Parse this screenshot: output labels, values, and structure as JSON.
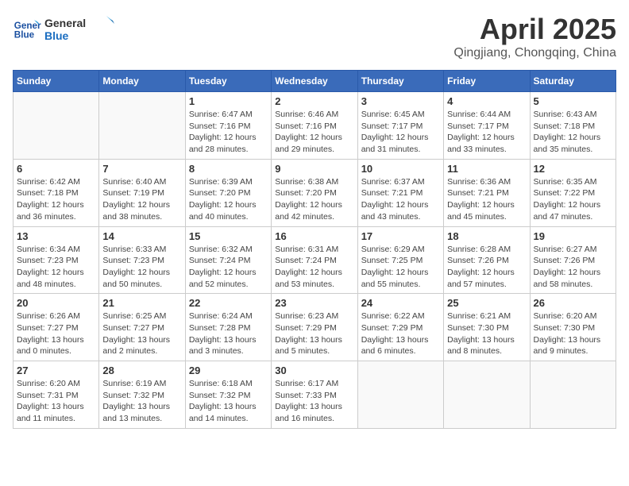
{
  "logo": {
    "line1": "General",
    "line2": "Blue"
  },
  "title": "April 2025",
  "location": "Qingjiang, Chongqing, China",
  "weekdays": [
    "Sunday",
    "Monday",
    "Tuesday",
    "Wednesday",
    "Thursday",
    "Friday",
    "Saturday"
  ],
  "weeks": [
    [
      {
        "day": "",
        "info": ""
      },
      {
        "day": "",
        "info": ""
      },
      {
        "day": "1",
        "info": "Sunrise: 6:47 AM\nSunset: 7:16 PM\nDaylight: 12 hours and 28 minutes."
      },
      {
        "day": "2",
        "info": "Sunrise: 6:46 AM\nSunset: 7:16 PM\nDaylight: 12 hours and 29 minutes."
      },
      {
        "day": "3",
        "info": "Sunrise: 6:45 AM\nSunset: 7:17 PM\nDaylight: 12 hours and 31 minutes."
      },
      {
        "day": "4",
        "info": "Sunrise: 6:44 AM\nSunset: 7:17 PM\nDaylight: 12 hours and 33 minutes."
      },
      {
        "day": "5",
        "info": "Sunrise: 6:43 AM\nSunset: 7:18 PM\nDaylight: 12 hours and 35 minutes."
      }
    ],
    [
      {
        "day": "6",
        "info": "Sunrise: 6:42 AM\nSunset: 7:18 PM\nDaylight: 12 hours and 36 minutes."
      },
      {
        "day": "7",
        "info": "Sunrise: 6:40 AM\nSunset: 7:19 PM\nDaylight: 12 hours and 38 minutes."
      },
      {
        "day": "8",
        "info": "Sunrise: 6:39 AM\nSunset: 7:20 PM\nDaylight: 12 hours and 40 minutes."
      },
      {
        "day": "9",
        "info": "Sunrise: 6:38 AM\nSunset: 7:20 PM\nDaylight: 12 hours and 42 minutes."
      },
      {
        "day": "10",
        "info": "Sunrise: 6:37 AM\nSunset: 7:21 PM\nDaylight: 12 hours and 43 minutes."
      },
      {
        "day": "11",
        "info": "Sunrise: 6:36 AM\nSunset: 7:21 PM\nDaylight: 12 hours and 45 minutes."
      },
      {
        "day": "12",
        "info": "Sunrise: 6:35 AM\nSunset: 7:22 PM\nDaylight: 12 hours and 47 minutes."
      }
    ],
    [
      {
        "day": "13",
        "info": "Sunrise: 6:34 AM\nSunset: 7:23 PM\nDaylight: 12 hours and 48 minutes."
      },
      {
        "day": "14",
        "info": "Sunrise: 6:33 AM\nSunset: 7:23 PM\nDaylight: 12 hours and 50 minutes."
      },
      {
        "day": "15",
        "info": "Sunrise: 6:32 AM\nSunset: 7:24 PM\nDaylight: 12 hours and 52 minutes."
      },
      {
        "day": "16",
        "info": "Sunrise: 6:31 AM\nSunset: 7:24 PM\nDaylight: 12 hours and 53 minutes."
      },
      {
        "day": "17",
        "info": "Sunrise: 6:29 AM\nSunset: 7:25 PM\nDaylight: 12 hours and 55 minutes."
      },
      {
        "day": "18",
        "info": "Sunrise: 6:28 AM\nSunset: 7:26 PM\nDaylight: 12 hours and 57 minutes."
      },
      {
        "day": "19",
        "info": "Sunrise: 6:27 AM\nSunset: 7:26 PM\nDaylight: 12 hours and 58 minutes."
      }
    ],
    [
      {
        "day": "20",
        "info": "Sunrise: 6:26 AM\nSunset: 7:27 PM\nDaylight: 13 hours and 0 minutes."
      },
      {
        "day": "21",
        "info": "Sunrise: 6:25 AM\nSunset: 7:27 PM\nDaylight: 13 hours and 2 minutes."
      },
      {
        "day": "22",
        "info": "Sunrise: 6:24 AM\nSunset: 7:28 PM\nDaylight: 13 hours and 3 minutes."
      },
      {
        "day": "23",
        "info": "Sunrise: 6:23 AM\nSunset: 7:29 PM\nDaylight: 13 hours and 5 minutes."
      },
      {
        "day": "24",
        "info": "Sunrise: 6:22 AM\nSunset: 7:29 PM\nDaylight: 13 hours and 6 minutes."
      },
      {
        "day": "25",
        "info": "Sunrise: 6:21 AM\nSunset: 7:30 PM\nDaylight: 13 hours and 8 minutes."
      },
      {
        "day": "26",
        "info": "Sunrise: 6:20 AM\nSunset: 7:30 PM\nDaylight: 13 hours and 9 minutes."
      }
    ],
    [
      {
        "day": "27",
        "info": "Sunrise: 6:20 AM\nSunset: 7:31 PM\nDaylight: 13 hours and 11 minutes."
      },
      {
        "day": "28",
        "info": "Sunrise: 6:19 AM\nSunset: 7:32 PM\nDaylight: 13 hours and 13 minutes."
      },
      {
        "day": "29",
        "info": "Sunrise: 6:18 AM\nSunset: 7:32 PM\nDaylight: 13 hours and 14 minutes."
      },
      {
        "day": "30",
        "info": "Sunrise: 6:17 AM\nSunset: 7:33 PM\nDaylight: 13 hours and 16 minutes."
      },
      {
        "day": "",
        "info": ""
      },
      {
        "day": "",
        "info": ""
      },
      {
        "day": "",
        "info": ""
      }
    ]
  ]
}
